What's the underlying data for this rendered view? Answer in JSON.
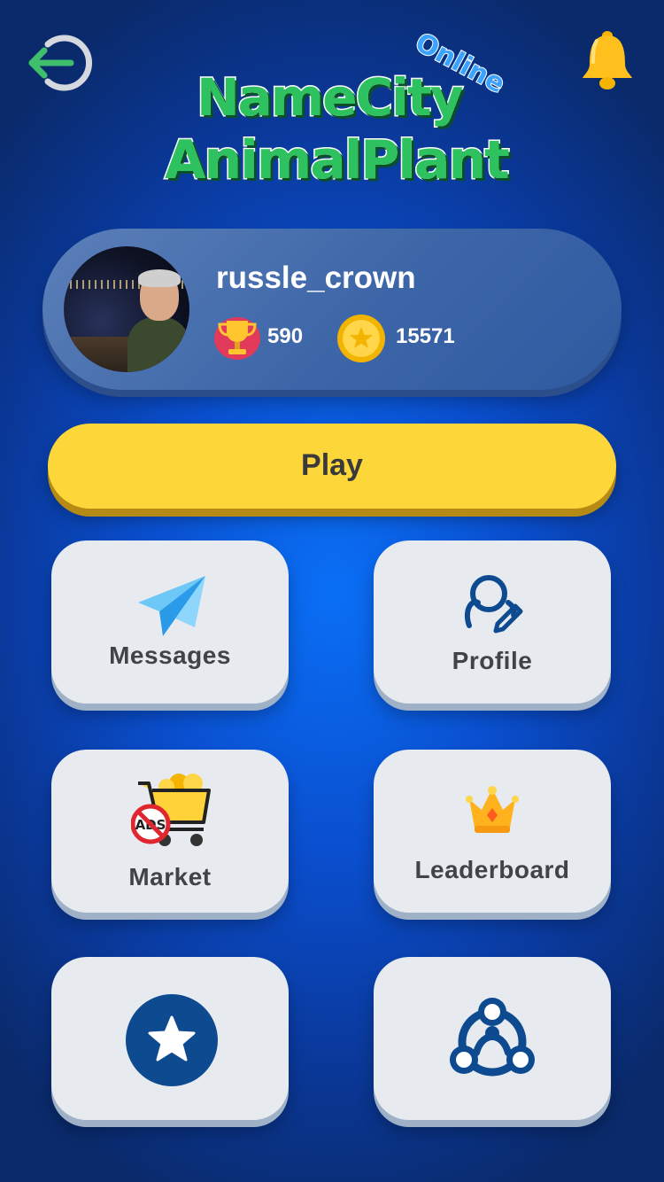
{
  "header": {
    "back_icon": "logout-arrow-icon",
    "notification_icon": "bell-icon",
    "logo": {
      "line1": "NameCity",
      "line2": "AnimalPlant",
      "badge": "Online"
    }
  },
  "profile": {
    "username": "russle_crown",
    "trophies": "590",
    "coins": "15571"
  },
  "play": {
    "label": "Play"
  },
  "menu": [
    {
      "label": "Messages",
      "icon": "paper-plane-icon"
    },
    {
      "label": "Profile",
      "icon": "user-edit-icon"
    },
    {
      "label": "Market",
      "icon": "no-ads-cart-icon"
    },
    {
      "label": "Leaderboard",
      "icon": "crown-icon"
    },
    {
      "label": "",
      "icon": "star-circle-icon"
    },
    {
      "label": "",
      "icon": "share-network-icon"
    }
  ],
  "colors": {
    "background": "#0a4fcf",
    "play": "#fdd73a",
    "tile": "#e7ebf0",
    "icon_blue": "#0d4a8f",
    "logo_green": "#2dc25f",
    "back_green": "#3fbf6b"
  }
}
